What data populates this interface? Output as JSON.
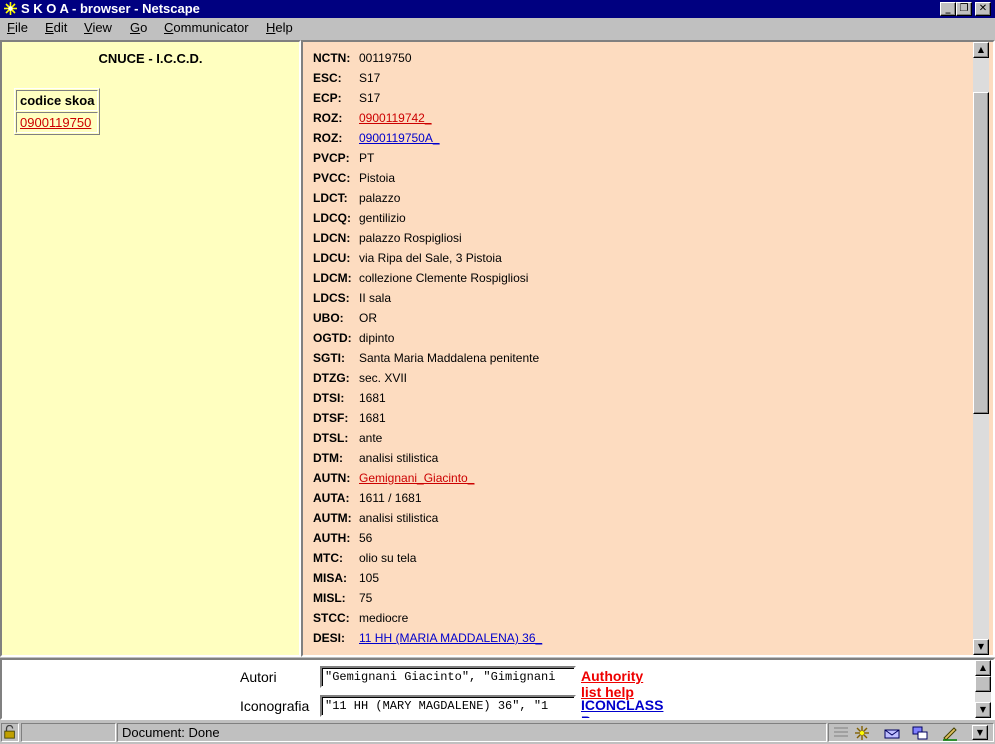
{
  "window": {
    "title": "S K O A - browser - Netscape"
  },
  "menu": [
    {
      "label": "File"
    },
    {
      "label": "Edit"
    },
    {
      "label": "View"
    },
    {
      "label": "Go"
    },
    {
      "label": "Communicator"
    },
    {
      "label": "Help"
    }
  ],
  "left": {
    "org": "CNUCE - I.C.C.D.",
    "table_header": "codice skoa",
    "code_link": "0900119750"
  },
  "fields": [
    {
      "label": "NCTN:",
      "value": "00119750",
      "link": ""
    },
    {
      "label": "ESC:",
      "value": "S17",
      "link": ""
    },
    {
      "label": "ECP:",
      "value": "S17",
      "link": ""
    },
    {
      "label": "ROZ:",
      "value": "0900119742_",
      "link": "red"
    },
    {
      "label": "ROZ:",
      "value": "0900119750A_",
      "link": "blue"
    },
    {
      "label": "PVCP:",
      "value": "PT",
      "link": ""
    },
    {
      "label": "PVCC:",
      "value": "Pistoia",
      "link": ""
    },
    {
      "label": "LDCT:",
      "value": "palazzo",
      "link": ""
    },
    {
      "label": "LDCQ:",
      "value": "gentilizio",
      "link": ""
    },
    {
      "label": "LDCN:",
      "value": "palazzo Rospigliosi",
      "link": ""
    },
    {
      "label": "LDCU:",
      "value": "via Ripa del Sale, 3 Pistoia",
      "link": ""
    },
    {
      "label": "LDCM:",
      "value": "collezione Clemente Rospigliosi",
      "link": ""
    },
    {
      "label": "LDCS:",
      "value": "II sala",
      "link": ""
    },
    {
      "label": "UBO:",
      "value": "OR",
      "link": ""
    },
    {
      "label": "OGTD:",
      "value": "dipinto",
      "link": ""
    },
    {
      "label": "SGTI:",
      "value": "Santa Maria Maddalena penitente",
      "link": ""
    },
    {
      "label": "DTZG:",
      "value": "sec. XVII",
      "link": ""
    },
    {
      "label": "DTSI:",
      "value": "1681",
      "link": ""
    },
    {
      "label": "DTSF:",
      "value": "1681",
      "link": ""
    },
    {
      "label": "DTSL:",
      "value": "ante",
      "link": ""
    },
    {
      "label": "DTM:",
      "value": "analisi stilistica",
      "link": ""
    },
    {
      "label": "AUTN:",
      "value": "Gemignani_Giacinto_",
      "link": "red"
    },
    {
      "label": "AUTA:",
      "value": "1611 / 1681",
      "link": ""
    },
    {
      "label": "AUTM:",
      "value": "analisi stilistica",
      "link": ""
    },
    {
      "label": "AUTH:",
      "value": "56",
      "link": ""
    },
    {
      "label": "MTC:",
      "value": "olio su tela",
      "link": ""
    },
    {
      "label": "MISA:",
      "value": "105",
      "link": ""
    },
    {
      "label": "MISL:",
      "value": "75",
      "link": ""
    },
    {
      "label": "STCC:",
      "value": "mediocre",
      "link": ""
    },
    {
      "label": "DESI:",
      "value": "11 HH (MARIA MADDALENA) 36_",
      "link": "blue"
    }
  ],
  "bottom": {
    "autori": {
      "label": "Autori",
      "value": "\"Gemignani Giacinto\", \"Gimignani",
      "link": "Authority list help",
      "link_color": "#ee0000"
    },
    "iconografia": {
      "label": "Iconografia",
      "value": "\"11 HH (MARY MAGDALENE) 36\", \"1",
      "link": "ICONCLASS Browser",
      "link_color": "#0000cc"
    }
  },
  "status": {
    "text": "Document: Done"
  }
}
